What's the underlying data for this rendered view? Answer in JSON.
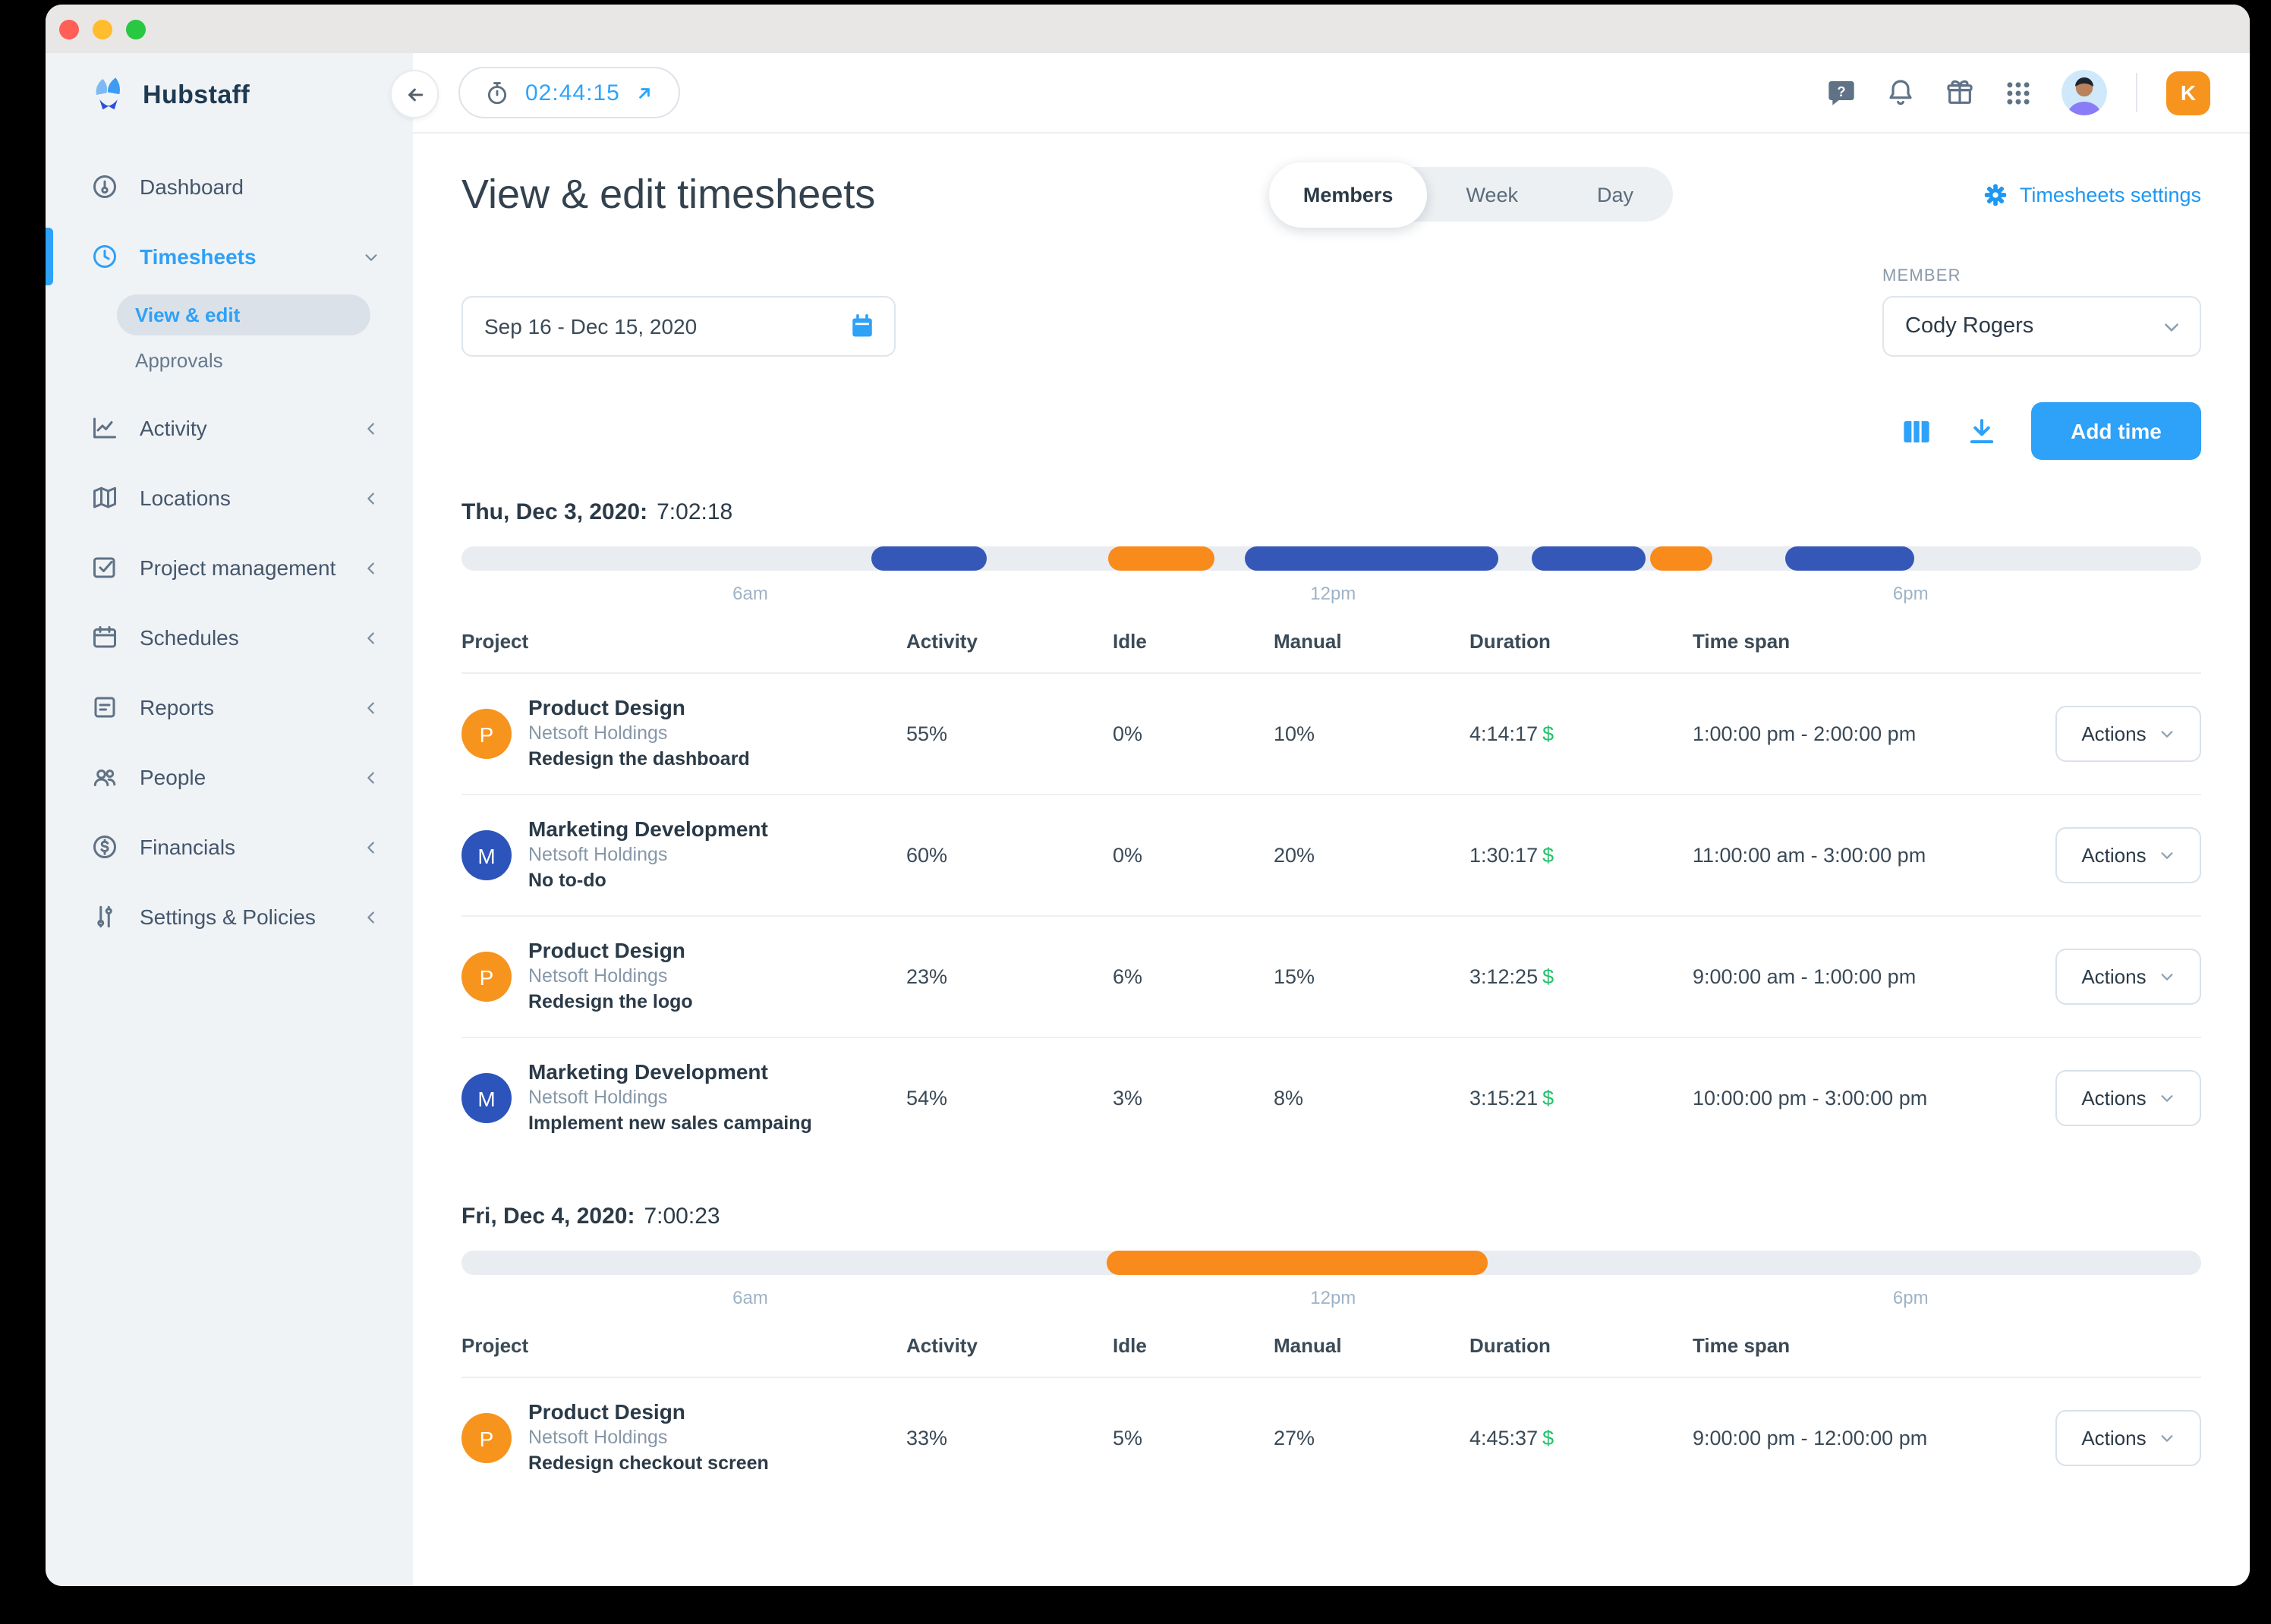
{
  "timer": {
    "time": "02:44:15"
  },
  "sidebar": {
    "logo_text": "Hubstaff",
    "items": [
      {
        "label": "Dashboard"
      },
      {
        "label": "Timesheets"
      },
      {
        "label": "Activity"
      },
      {
        "label": "Locations"
      },
      {
        "label": "Project management"
      },
      {
        "label": "Schedules"
      },
      {
        "label": "Reports"
      },
      {
        "label": "People"
      },
      {
        "label": "Financials"
      },
      {
        "label": "Settings & Policies"
      }
    ],
    "subitems": [
      {
        "label": "View & edit"
      },
      {
        "label": "Approvals"
      }
    ]
  },
  "header": {
    "title": "View & edit timesheets",
    "tabs": [
      {
        "label": "Members"
      },
      {
        "label": "Week"
      },
      {
        "label": "Day"
      }
    ],
    "active_tab": "Members",
    "settings_link": "Timesheets settings",
    "org_initial": "K"
  },
  "filters": {
    "date_range": "Sep 16 - Dec 15, 2020",
    "member_label": "MEMBER",
    "member_value": "Cody Rogers",
    "add_time_label": "Add time"
  },
  "table": {
    "columns": [
      "Project",
      "Activity",
      "Idle",
      "Manual",
      "Duration",
      "Time span"
    ],
    "actions_label": "Actions"
  },
  "days": [
    {
      "date_label": "Thu, Dec 3, 2020:",
      "total": "7:02:18",
      "timeline": {
        "ticks": [
          {
            "label": "6am",
            "pos_pct": 16.6
          },
          {
            "label": "12pm",
            "pos_pct": 50.1
          },
          {
            "label": "6pm",
            "pos_pct": 83.3
          }
        ],
        "segments": [
          {
            "color": "blue",
            "left_pct": 23.6,
            "width_pct": 6.6
          },
          {
            "color": "orange",
            "left_pct": 37.2,
            "width_pct": 6.1
          },
          {
            "color": "blue",
            "left_pct": 45.0,
            "width_pct": 14.6
          },
          {
            "color": "blue",
            "left_pct": 61.5,
            "width_pct": 6.6
          },
          {
            "color": "orange",
            "left_pct": 68.3,
            "width_pct": 3.6
          },
          {
            "color": "blue",
            "left_pct": 76.1,
            "width_pct": 7.4
          }
        ]
      },
      "rows": [
        {
          "initial": "P",
          "color": "orange",
          "project": "Product Design",
          "company": "Netsoft Holdings",
          "task": "Redesign the dashboard",
          "activity": "55%",
          "idle": "0%",
          "manual": "10%",
          "duration": "4:14:17",
          "currency": "$",
          "timespan": "1:00:00 pm - 2:00:00 pm"
        },
        {
          "initial": "M",
          "color": "blue",
          "project": "Marketing Development",
          "company": "Netsoft Holdings",
          "task": "No to-do",
          "activity": "60%",
          "idle": "0%",
          "manual": "20%",
          "duration": "1:30:17",
          "currency": "$",
          "timespan": "11:00:00 am - 3:00:00 pm"
        },
        {
          "initial": "P",
          "color": "orange",
          "project": "Product Design",
          "company": "Netsoft Holdings",
          "task": "Redesign the logo",
          "activity": "23%",
          "idle": "6%",
          "manual": "15%",
          "duration": "3:12:25",
          "currency": "$",
          "timespan": "9:00:00 am - 1:00:00 pm"
        },
        {
          "initial": "M",
          "color": "blue",
          "project": "Marketing Development",
          "company": "Netsoft Holdings",
          "task": "Implement new sales campaing",
          "activity": "54%",
          "idle": "3%",
          "manual": "8%",
          "duration": "3:15:21",
          "currency": "$",
          "timespan": "10:00:00 pm - 3:00:00 pm"
        }
      ]
    },
    {
      "date_label": "Fri, Dec 4, 2020:",
      "total": "7:00:23",
      "timeline": {
        "ticks": [
          {
            "label": "6am",
            "pos_pct": 16.6
          },
          {
            "label": "12pm",
            "pos_pct": 50.1
          },
          {
            "label": "6pm",
            "pos_pct": 83.3
          }
        ],
        "segments": [
          {
            "color": "orange",
            "left_pct": 37.1,
            "width_pct": 21.9
          }
        ]
      },
      "rows": [
        {
          "initial": "P",
          "color": "orange",
          "project": "Product Design",
          "company": "Netsoft Holdings",
          "task": "Redesign checkout screen",
          "activity": "33%",
          "idle": "5%",
          "manual": "27%",
          "duration": "4:45:37",
          "currency": "$",
          "timespan": "9:00:00 pm - 12:00:00 pm"
        }
      ]
    }
  ],
  "icons": {
    "timer": "stopwatch-icon",
    "back": "arrow-left-icon",
    "help": "question-bubble-icon",
    "notifications": "bell-icon",
    "promo": "gift-icon",
    "apps": "grid-icon",
    "settings": "gear-icon",
    "calendar": "calendar-icon",
    "columns": "columns-icon",
    "export": "download-icon",
    "expand": "chevron-down-icon",
    "collapsed": "chevron-left-icon"
  },
  "colors": {
    "accent_blue": "#2ea1f8",
    "link_blue": "#1e97f3",
    "segment_blue": "#3557b8",
    "segment_orange": "#f98a1c",
    "avatar_orange": "#f7941e",
    "avatar_blue": "#2c54ba",
    "money_green": "#23c16b",
    "track_gray": "#e9ecf0",
    "sidebar_bg": "#f0f3f6",
    "org_badge_orange": "#f7941e"
  }
}
